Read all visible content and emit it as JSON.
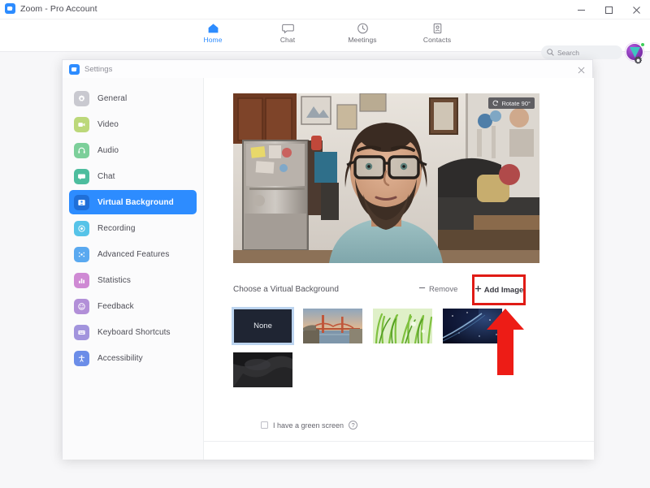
{
  "window": {
    "title": "Zoom - Pro Account",
    "logo_icon": "zoom-camera-icon",
    "controls": {
      "minimize": "minimize-icon",
      "maximize": "maximize-icon",
      "close": "close-icon"
    }
  },
  "topnav": {
    "items": [
      {
        "label": "Home",
        "icon": "home-icon",
        "active": true
      },
      {
        "label": "Chat",
        "icon": "chat-bubble-icon",
        "active": false
      },
      {
        "label": "Meetings",
        "icon": "clock-icon",
        "active": false
      },
      {
        "label": "Contacts",
        "icon": "contacts-icon",
        "active": false
      }
    ],
    "search": {
      "placeholder": "Search",
      "icon": "search-icon"
    },
    "avatar": {
      "name": "user-avatar",
      "status": "available"
    },
    "gear": "gear-icon"
  },
  "settings": {
    "title": "Settings",
    "logo_icon": "zoom-camera-icon",
    "close_icon": "close-icon",
    "sidebar": [
      {
        "label": "General",
        "icon": "gear-icon",
        "color": "#c9c9d0",
        "active": false
      },
      {
        "label": "Video",
        "icon": "video-camera-icon",
        "color": "#bcd87a",
        "active": false
      },
      {
        "label": "Audio",
        "icon": "headset-icon",
        "color": "#7ccf9a",
        "active": false
      },
      {
        "label": "Chat",
        "icon": "chat-bubble-icon",
        "color": "#4dbd9e",
        "active": false
      },
      {
        "label": "Virtual Background",
        "icon": "person-card-icon",
        "color": "#2d8cff",
        "active": true
      },
      {
        "label": "Recording",
        "icon": "record-dot-icon",
        "color": "#56c3e8",
        "active": false
      },
      {
        "label": "Advanced Features",
        "icon": "sparkle-icon",
        "color": "#5aa9f0",
        "active": false
      },
      {
        "label": "Statistics",
        "icon": "bar-chart-icon",
        "color": "#cf8ad4",
        "active": false
      },
      {
        "label": "Feedback",
        "icon": "smiley-icon",
        "color": "#b28fd8",
        "active": false
      },
      {
        "label": "Keyboard Shortcuts",
        "icon": "keyboard-icon",
        "color": "#a294dd",
        "active": false
      },
      {
        "label": "Accessibility",
        "icon": "accessibility-icon",
        "color": "#6b8de8",
        "active": false
      }
    ],
    "preview": {
      "rotate_label": "Rotate 90°",
      "rotate_icon": "rotate-icon",
      "description": "webcam self-view of bearded man with glasses in a room"
    },
    "controls": {
      "choose_label": "Choose a Virtual Background",
      "remove_label": "Remove",
      "remove_icon": "minus-icon",
      "add_image_label": "Add Image",
      "add_image_icon": "plus-icon",
      "highlight_color": "#e01b15"
    },
    "thumbnails": [
      {
        "label": "None",
        "type": "none",
        "selected": true
      },
      {
        "label": "",
        "type": "bridge",
        "selected": false
      },
      {
        "label": "",
        "type": "grass",
        "selected": false
      },
      {
        "label": "",
        "type": "space",
        "selected": false
      },
      {
        "label": "",
        "type": "dark",
        "selected": false
      }
    ],
    "green_screen": {
      "label": "I have a green screen",
      "checked": false,
      "help_icon": "question-mark-icon",
      "help_glyph": "?"
    }
  },
  "annotation": {
    "arrow": "red-up-arrow",
    "color": "#ed1c16"
  }
}
